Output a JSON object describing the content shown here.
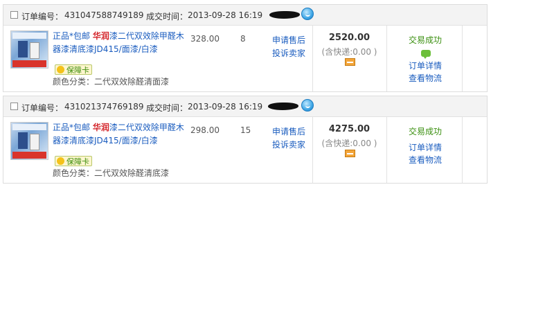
{
  "orders": [
    {
      "order_no_label": "订单编号：",
      "order_no": "431047588749189",
      "deal_time_label": "成交时间：",
      "deal_time": "2013-09-28 16:19",
      "item_title_prefix": "正品*包邮 ",
      "item_brand": "华润",
      "item_title_rest": "漆二代双效除甲醛木器漆清底漆JD415/面漆/白漆",
      "guarantee_badge": "保障卡",
      "spec": "颜色分类：二代双效除醛清面漆",
      "unit_price": "328.00",
      "quantity": "8",
      "after_sale": "申请售后",
      "complain": "投诉卖家",
      "total": "2520.00",
      "shipping": "(含快递:0.00 )",
      "status": "交易成功",
      "detail_link": "订单详情",
      "logistics_link": "查看物流"
    },
    {
      "order_no_label": "订单编号：",
      "order_no": "431021374769189",
      "deal_time_label": "成交时间：",
      "deal_time": "2013-09-28 16:19",
      "item_title_prefix": "正品*包邮 ",
      "item_brand": "华润",
      "item_title_rest": "漆二代双效除甲醛木器漆清底漆JD415/面漆/白漆",
      "guarantee_badge": "保障卡",
      "spec": "颜色分类：二代双效除醛清底漆",
      "unit_price": "298.00",
      "quantity": "15",
      "after_sale": "申请售后",
      "complain": "投诉卖家",
      "total": "4275.00",
      "shipping": "(含快递:0.00 )",
      "status": "交易成功",
      "detail_link": "订单详情",
      "logistics_link": "查看物流"
    }
  ],
  "colors": {
    "link": "#1a5cbf",
    "success": "#3a8f0f",
    "brand": "#d4262b"
  },
  "icons": [
    "checkbox",
    "redacted-seller",
    "wangwang-chat-icon",
    "product-thumbnail",
    "guarantee-icon",
    "payment-card-icon",
    "chat-bubble-icon"
  ]
}
